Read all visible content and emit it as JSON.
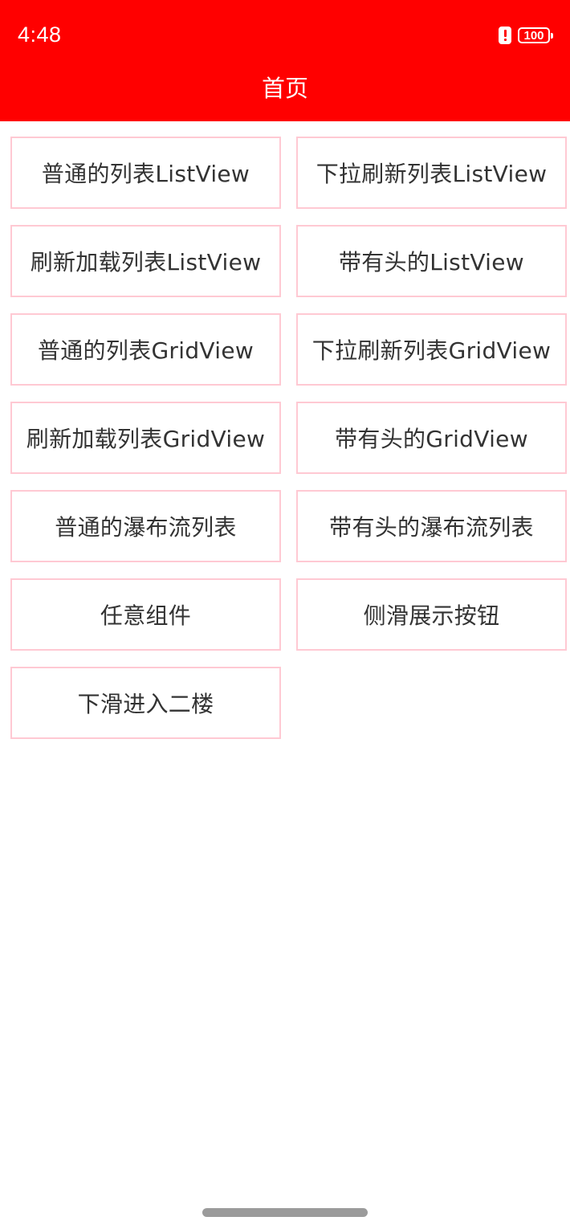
{
  "status_bar": {
    "time": "4:48",
    "battery_level": "100",
    "alert_icon": "alert-icon",
    "battery_icon": "battery-icon"
  },
  "header": {
    "title": "首页",
    "background_color": "#ff0000"
  },
  "buttons": [
    {
      "label": "普通的列表ListView"
    },
    {
      "label": "下拉刷新列表ListView"
    },
    {
      "label": "刷新加载列表ListView"
    },
    {
      "label": "带有头的ListView"
    },
    {
      "label": "普通的列表GridView"
    },
    {
      "label": "下拉刷新列表GridView"
    },
    {
      "label": "刷新加载列表GridView"
    },
    {
      "label": "带有头的GridView"
    },
    {
      "label": "普通的瀑布流列表"
    },
    {
      "label": "带有头的瀑布流列表"
    },
    {
      "label": "任意组件"
    },
    {
      "label": "侧滑展示按钮"
    },
    {
      "label": "下滑进入二楼"
    }
  ],
  "colors": {
    "accent": "#ff0000",
    "button_border": "#ffc9d3",
    "button_text": "#333333"
  }
}
